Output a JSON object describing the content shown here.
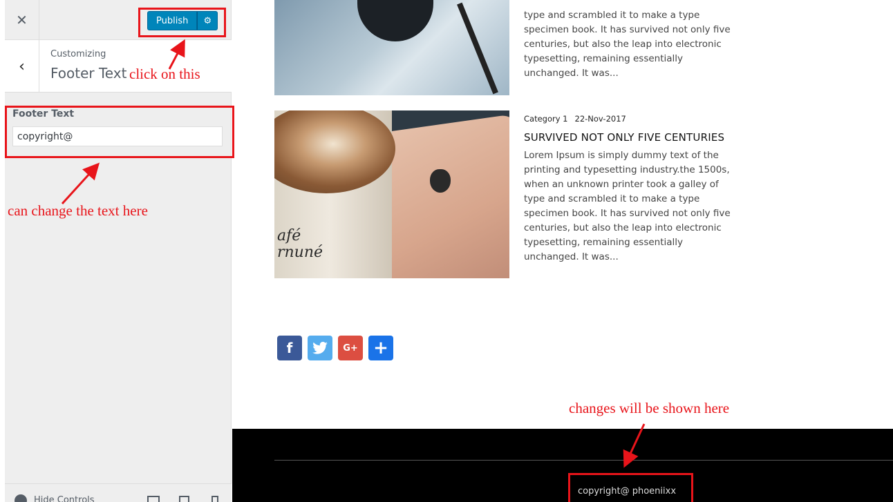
{
  "sidebar": {
    "close_icon": "close-icon",
    "publish_label": "Publish",
    "settings_icon": "gear-icon",
    "back_icon": "chevron-left-icon",
    "customizing_label": "Customizing",
    "section_title": "Footer Text",
    "control_label": "Footer Text",
    "control_value": "copyright@",
    "hide_controls_label": "Hide Controls",
    "devices": [
      "desktop-icon",
      "tablet-icon",
      "mobile-icon"
    ]
  },
  "preview": {
    "top_post": {
      "excerpt_lines": [
        "type and scrambled it to make a type",
        "specimen book. It has survived not only five",
        "centuries, but also the leap into electronic",
        "typesetting, remaining essentially",
        "unchanged. It was..."
      ]
    },
    "post": {
      "category": "Category 1",
      "date": "22-Nov-2017",
      "title": "SURVIVED NOT ONLY FIVE CENTURIES",
      "cup_text_lines": [
        "afé",
        "rnuné"
      ],
      "excerpt_lines": [
        "Lorem Ipsum is simply dummy text of the",
        "printing and typesetting industry.the 1500s,",
        "when an unknown printer took a galley of",
        "type and scrambled it to make a type",
        "specimen book. It has survived not only five",
        "centuries, but also the leap into electronic",
        "typesetting, remaining essentially",
        "unchanged. It was..."
      ]
    },
    "social": {
      "facebook": "f",
      "googleplus": "G+",
      "share": "+"
    },
    "footer_text": "copyright@ phoeniixx"
  },
  "annotations": {
    "click_note": "click on this",
    "change_note": "can change the text here",
    "shown_note": "changes will be shown here",
    "color": "#e8141a"
  },
  "colors": {
    "publish_blue": "#0085ba",
    "sidebar_bg": "#eeeeee",
    "footer_bg": "#000000"
  }
}
